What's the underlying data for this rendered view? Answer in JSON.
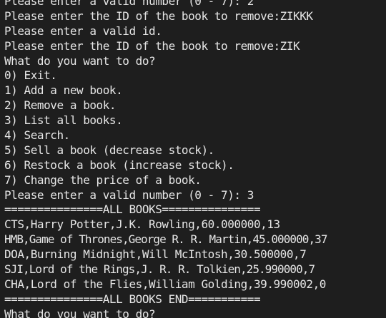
{
  "terminal": {
    "background": "#1e1e1e",
    "foreground": "#e6e6e6",
    "lines": [
      "Please enter a valid number (0 - 7): 2",
      "Please enter the ID of the book to remove:ZIKKK",
      "Please enter a valid id.",
      "Please enter the ID of the book to remove:ZIK",
      "What do you want to do?",
      "0) Exit.",
      "1) Add a new book.",
      "2) Remove a book.",
      "3) List all books.",
      "4) Search.",
      "5) Sell a book (decrease stock).",
      "6) Restock a book (increase stock).",
      "7) Change the price of a book.",
      "Please enter a valid number (0 - 7): 3",
      "===============ALL BOOKS===============",
      "CTS,Harry Potter,J.K. Rowling,60.000000,13",
      "HMB,Game of Thrones,George R. R. Martin,45.000000,37",
      "DOA,Burning Midnight,Will McIntosh,30.500000,7",
      "SJI,Lord of the Rings,J. R. R. Tolkien,25.990000,7",
      "CHA,Lord of the Flies,William Golding,39.990002,0",
      "===============ALL BOOKS END===========",
      "What do you want to do?"
    ]
  }
}
